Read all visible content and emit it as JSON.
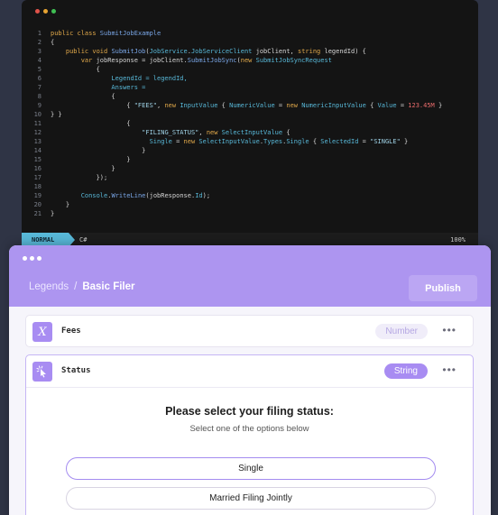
{
  "editor": {
    "window_dots": [
      "#e0534a",
      "#e6a332",
      "#3fbf53"
    ],
    "lines": [
      {
        "n": "1",
        "segs": [
          {
            "t": "public class ",
            "c": "#e0a84a"
          },
          {
            "t": "SubmitJobExample",
            "c": "#7aa7e8"
          }
        ]
      },
      {
        "n": "2",
        "segs": [
          {
            "t": "{",
            "c": "#d6d6d6"
          }
        ]
      },
      {
        "n": "3",
        "segs": [
          {
            "t": "    public void ",
            "c": "#e0a84a"
          },
          {
            "t": "SubmitJob",
            "c": "#7aa7e8"
          },
          {
            "t": "(",
            "c": "#d6d6d6"
          },
          {
            "t": "JobService",
            "c": "#58b8d8"
          },
          {
            "t": ".",
            "c": "#d6d6d6"
          },
          {
            "t": "JobServiceClient",
            "c": "#58b8d8"
          },
          {
            "t": " jobClient, ",
            "c": "#d6d6d6"
          },
          {
            "t": "string",
            "c": "#e0a84a"
          },
          {
            "t": " legendId) {",
            "c": "#d6d6d6"
          }
        ]
      },
      {
        "n": "4",
        "segs": [
          {
            "t": "        var ",
            "c": "#e0a84a"
          },
          {
            "t": "jobResponse = jobClient.",
            "c": "#d6d6d6"
          },
          {
            "t": "SubmitJobSync",
            "c": "#7aa7e8"
          },
          {
            "t": "(",
            "c": "#d6d6d6"
          },
          {
            "t": "new ",
            "c": "#e0a84a"
          },
          {
            "t": "SubmitJobSyncRequest",
            "c": "#58b8d8"
          }
        ]
      },
      {
        "n": "5",
        "segs": [
          {
            "t": "            {",
            "c": "#d6d6d6"
          }
        ]
      },
      {
        "n": "6",
        "segs": [
          {
            "t": "                LegendId = legendId,",
            "c": "#58b8d8"
          }
        ]
      },
      {
        "n": "7",
        "segs": [
          {
            "t": "                Answers =",
            "c": "#58b8d8"
          }
        ]
      },
      {
        "n": "8",
        "segs": [
          {
            "t": "                {",
            "c": "#d6d6d6"
          }
        ]
      },
      {
        "n": "9",
        "segs": [
          {
            "t": "                    { ",
            "c": "#d6d6d6"
          },
          {
            "t": "\"FEES\"",
            "c": "#9fd2e6"
          },
          {
            "t": ", ",
            "c": "#d6d6d6"
          },
          {
            "t": "new ",
            "c": "#e0a84a"
          },
          {
            "t": "InputValue",
            "c": "#58b8d8"
          },
          {
            "t": " { ",
            "c": "#d6d6d6"
          },
          {
            "t": "NumericValue",
            "c": "#58b8d8"
          },
          {
            "t": " = ",
            "c": "#d6d6d6"
          },
          {
            "t": "new ",
            "c": "#e0a84a"
          },
          {
            "t": "NumericInputValue",
            "c": "#58b8d8"
          },
          {
            "t": " { ",
            "c": "#d6d6d6"
          },
          {
            "t": "Value",
            "c": "#58b8d8"
          },
          {
            "t": " = ",
            "c": "#d6d6d6"
          },
          {
            "t": "123.45M",
            "c": "#e86b6b"
          },
          {
            "t": " }",
            "c": "#d6d6d6"
          }
        ]
      },
      {
        "n": "10",
        "segs": [
          {
            "t": "} }",
            "c": "#d6d6d6"
          }
        ]
      },
      {
        "n": "11",
        "segs": [
          {
            "t": "                    {",
            "c": "#d6d6d6"
          }
        ]
      },
      {
        "n": "12",
        "segs": [
          {
            "t": "                        ",
            "c": "#d6d6d6"
          },
          {
            "t": "\"FILING_STATUS\"",
            "c": "#9fd2e6"
          },
          {
            "t": ", ",
            "c": "#d6d6d6"
          },
          {
            "t": "new ",
            "c": "#e0a84a"
          },
          {
            "t": "SelectInputValue",
            "c": "#58b8d8"
          },
          {
            "t": " {",
            "c": "#d6d6d6"
          }
        ]
      },
      {
        "n": "13",
        "segs": [
          {
            "t": "                          ",
            "c": "#d6d6d6"
          },
          {
            "t": "Single",
            "c": "#58b8d8"
          },
          {
            "t": " = ",
            "c": "#d6d6d6"
          },
          {
            "t": "new ",
            "c": "#e0a84a"
          },
          {
            "t": "SelectInputValue",
            "c": "#58b8d8"
          },
          {
            "t": ".",
            "c": "#d6d6d6"
          },
          {
            "t": "Types",
            "c": "#58b8d8"
          },
          {
            "t": ".",
            "c": "#d6d6d6"
          },
          {
            "t": "Single",
            "c": "#58b8d8"
          },
          {
            "t": " { ",
            "c": "#d6d6d6"
          },
          {
            "t": "SelectedId",
            "c": "#58b8d8"
          },
          {
            "t": " = ",
            "c": "#d6d6d6"
          },
          {
            "t": "\"SINGLE\"",
            "c": "#9fd2e6"
          },
          {
            "t": " }",
            "c": "#d6d6d6"
          }
        ]
      },
      {
        "n": "14",
        "segs": [
          {
            "t": "                        }",
            "c": "#d6d6d6"
          }
        ]
      },
      {
        "n": "15",
        "segs": [
          {
            "t": "                    }",
            "c": "#d6d6d6"
          }
        ]
      },
      {
        "n": "16",
        "segs": [
          {
            "t": "                }",
            "c": "#d6d6d6"
          }
        ]
      },
      {
        "n": "17",
        "segs": [
          {
            "t": "            });",
            "c": "#d6d6d6"
          }
        ]
      },
      {
        "n": "18",
        "segs": [
          {
            "t": "",
            "c": "#d6d6d6"
          }
        ]
      },
      {
        "n": "19",
        "segs": [
          {
            "t": "        ",
            "c": "#d6d6d6"
          },
          {
            "t": "Console",
            "c": "#58b8d8"
          },
          {
            "t": ".",
            "c": "#d6d6d6"
          },
          {
            "t": "WriteLine",
            "c": "#7aa7e8"
          },
          {
            "t": "(jobResponse.",
            "c": "#d6d6d6"
          },
          {
            "t": "Id",
            "c": "#58b8d8"
          },
          {
            "t": ");",
            "c": "#d6d6d6"
          }
        ]
      },
      {
        "n": "20",
        "segs": [
          {
            "t": "    }",
            "c": "#d6d6d6"
          }
        ]
      },
      {
        "n": "21",
        "segs": [
          {
            "t": "}",
            "c": "#d6d6d6"
          }
        ]
      }
    ],
    "status_mode": "NORMAL",
    "status_lang": "C#",
    "status_percent": "100%"
  },
  "app": {
    "breadcrumb_root": "Legends",
    "breadcrumb_separator": "/",
    "breadcrumb_current": "Basic Filer",
    "publish_label": "Publish",
    "fields": [
      {
        "icon": "variable-x-icon",
        "icon_glyph": "𝑋",
        "name": "Fees",
        "type": "Number",
        "more": "•••"
      },
      {
        "icon": "cursor-click-icon",
        "name": "Status",
        "type": "String",
        "more": "•••"
      }
    ],
    "prompt_title": "Please select your filing status:",
    "prompt_subtitle": "Select one  of the options below",
    "options": [
      "Single",
      "Married Filing Jointly"
    ]
  },
  "colors": {
    "accent": "#a88cf2",
    "header_purple": "#ad95f0",
    "status_mode_bg": "#58b8d8"
  }
}
